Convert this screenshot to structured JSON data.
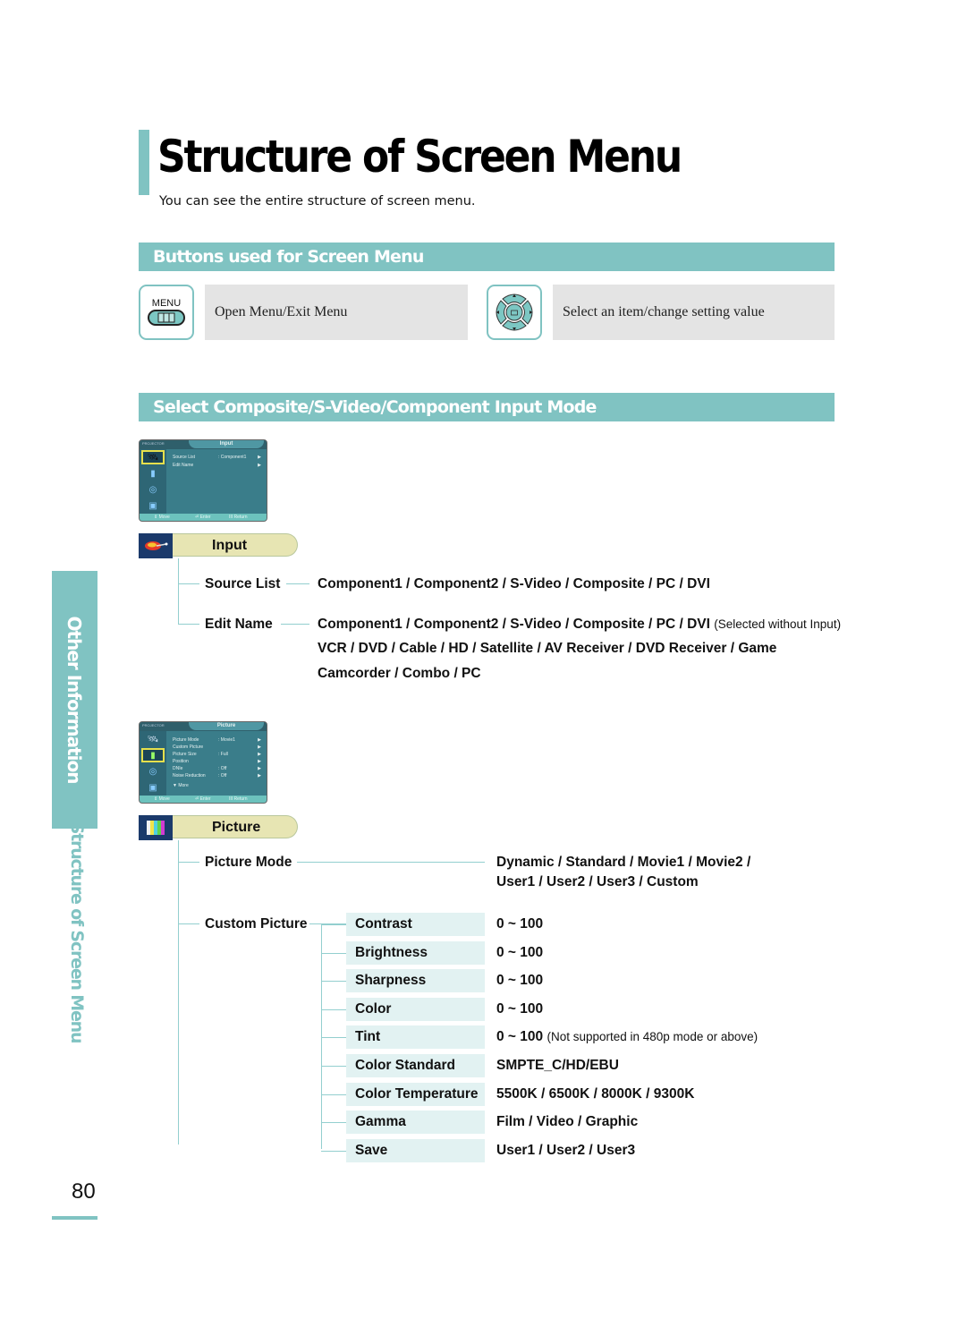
{
  "header": {
    "title": "Structure of Screen Menu",
    "subtitle": "You can see the entire structure of screen menu."
  },
  "buttons_section": {
    "title": "Buttons used for Screen Menu",
    "buttons": [
      {
        "icon": "menu-button-icon",
        "icon_label": "MENU",
        "description": "Open Menu/Exit Menu"
      },
      {
        "icon": "direction-pad-icon",
        "description": "Select an item/change setting value"
      }
    ]
  },
  "input_section": {
    "title": "Select Composite/S-Video/Component Input Mode"
  },
  "input_osd": {
    "brand": "PROJECTOR",
    "tab": "Input",
    "rows": [
      {
        "label": "Source List",
        "value": ": Component1",
        "arrow": "▶"
      },
      {
        "label": "Edit Name",
        "value": "",
        "arrow": "▶"
      }
    ],
    "footer": {
      "move": "⇕ Move",
      "enter": "⏎ Enter",
      "return": "III Return"
    }
  },
  "input_menu": {
    "label": "Input",
    "items": [
      {
        "label": "Source List",
        "values": [
          "Component1 / Component2 / S-Video / Composite / PC / DVI"
        ],
        "note": ""
      },
      {
        "label": "Edit Name",
        "values": [
          "Component1 / Component2 / S-Video / Composite / PC / DVI",
          "VCR / DVD / Cable / HD / Satellite / AV Receiver / DVD Receiver / Game",
          "Camcorder / Combo / PC"
        ],
        "note": "(Selected without Input)"
      }
    ]
  },
  "picture_osd": {
    "brand": "PROJECTOR",
    "tab": "Picture",
    "rows": [
      {
        "label": "Picture Mode",
        "value": ": Movie1",
        "arrow": "▶"
      },
      {
        "label": "Custom Picture",
        "value": "",
        "arrow": "▶"
      },
      {
        "label": "Picture Size",
        "value": ": Full",
        "arrow": "▶"
      },
      {
        "label": "Position",
        "value": "",
        "arrow": "▶"
      },
      {
        "label": "DNIe",
        "value": ": Off",
        "arrow": "▶"
      },
      {
        "label": "Noise Reduction",
        "value": ": Off",
        "arrow": "▶"
      },
      {
        "label": "▼ More",
        "value": "",
        "arrow": ""
      }
    ],
    "footer": {
      "move": "⇕ Move",
      "enter": "⏎ Enter",
      "return": "III Return"
    }
  },
  "picture_menu": {
    "label": "Picture",
    "picture_mode": {
      "label": "Picture Mode",
      "values": [
        "Dynamic / Standard / Movie1 / Movie2 /",
        "User1 / User2 / User3 / Custom"
      ]
    },
    "custom_picture": {
      "label": "Custom Picture",
      "items": [
        {
          "label": "Contrast",
          "value": "0 ~ 100",
          "note": ""
        },
        {
          "label": "Brightness",
          "value": "0 ~ 100",
          "note": ""
        },
        {
          "label": "Sharpness",
          "value": "0 ~ 100",
          "note": ""
        },
        {
          "label": "Color",
          "value": "0 ~ 100",
          "note": ""
        },
        {
          "label": "Tint",
          "value": "0 ~ 100",
          "note": "(Not supported in 480p mode or above)"
        },
        {
          "label": "Color Standard",
          "value": "SMPTE_C/HD/EBU",
          "note": ""
        },
        {
          "label": "Color Temperature",
          "value": "5500K / 6500K / 8000K / 9300K",
          "note": ""
        },
        {
          "label": "Gamma",
          "value": "Film / Video / Graphic",
          "note": ""
        },
        {
          "label": "Save",
          "value": "User1 / User2 / User3",
          "note": ""
        }
      ]
    }
  },
  "sidebar": {
    "chapter": "Other Information",
    "section": "Structure of Screen Menu",
    "page_number": "80"
  },
  "colors": {
    "accent": "#80c3c2",
    "category_label_bg": "#e7e5b3",
    "sub_item_bg": "#e2f2f2",
    "button_desc_bg": "#e4e4e4"
  }
}
